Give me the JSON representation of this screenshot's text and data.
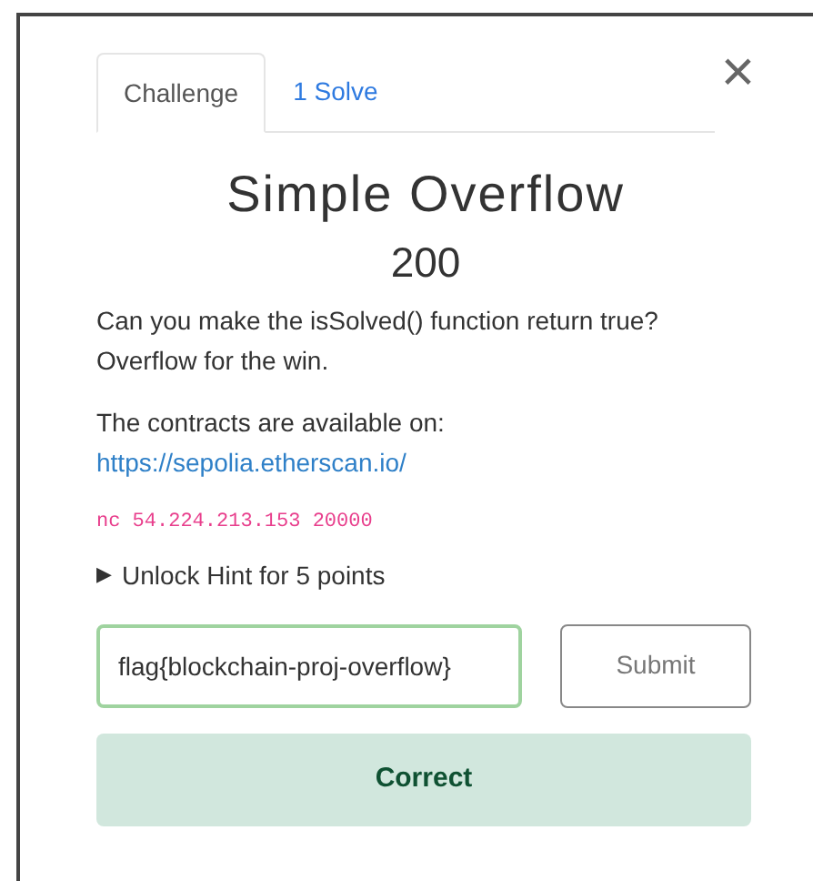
{
  "tabs": [
    {
      "label": "Challenge",
      "selected": true
    },
    {
      "label": "1 Solve",
      "selected": false
    }
  ],
  "close": "×",
  "challenge": {
    "title": "Simple Overflow",
    "points": "200",
    "description": [
      "Can you make the isSolved() function return true?",
      "Overflow for the win."
    ],
    "contracts_text": "The contracts are available on:",
    "contracts_link": "https://sepolia.etherscan.io/",
    "command": "nc 54.224.213.153 20000",
    "hint": {
      "arrow": "▶",
      "label": "Unlock Hint for 5 points"
    }
  },
  "answer": {
    "value": "flag{blockchain-proj-overflow}",
    "submit": "Submit"
  },
  "result": {
    "text": "Correct",
    "kind": "success"
  }
}
